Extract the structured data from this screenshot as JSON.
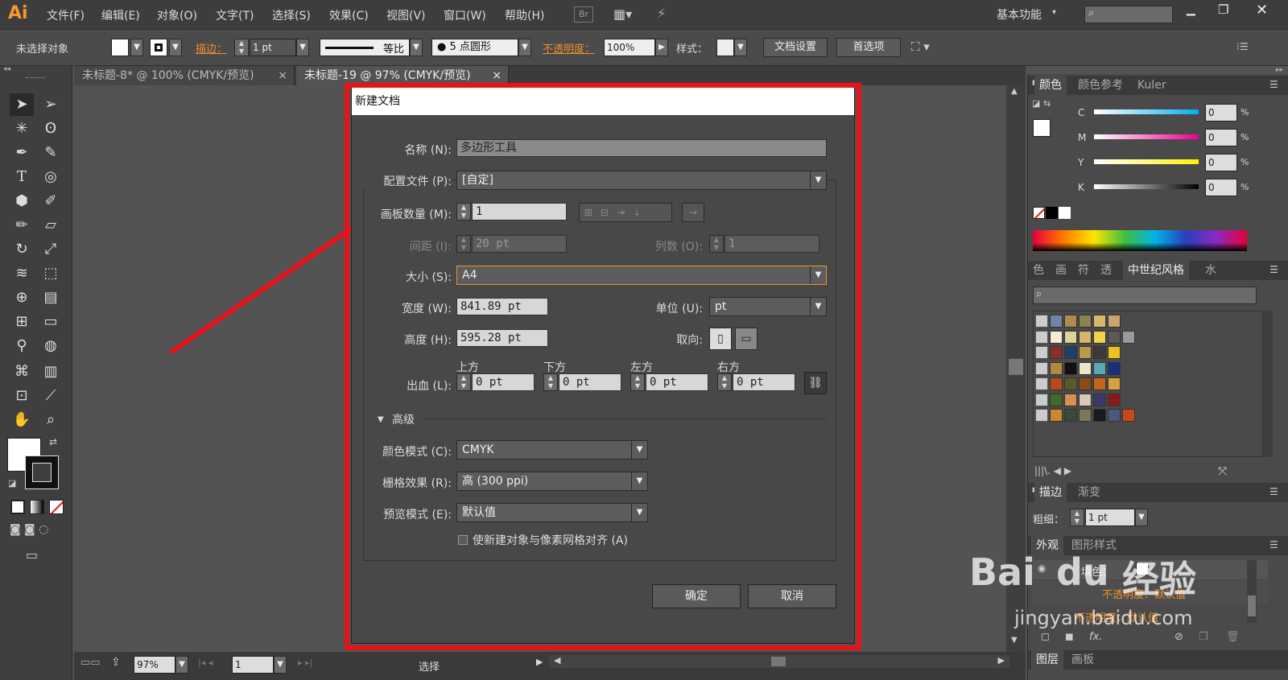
{
  "app": {
    "logo": "Ai",
    "workspace": "基本功能"
  },
  "menu": [
    "文件(F)",
    "编辑(E)",
    "对象(O)",
    "文字(T)",
    "选择(S)",
    "效果(C)",
    "视图(V)",
    "窗口(W)",
    "帮助(H)"
  ],
  "menu_extra": {
    "br": "Br"
  },
  "control": {
    "no_selection": "未选择对象",
    "stroke_label": "描边：",
    "stroke_value": "1 pt",
    "profile": "等比",
    "brush": "5 点圆形",
    "opacity_label": "不透明度：",
    "opacity_value": "100%",
    "style_label": "样式：",
    "doc_setup": "文档设置",
    "prefs": "首选项"
  },
  "tabs": [
    {
      "label": "未标题-8* @ 100% (CMYK/预览)",
      "close": "×"
    },
    {
      "label": "未标题-19 @ 97% (CMYK/预览)",
      "close": "×"
    }
  ],
  "dialog": {
    "title": "新建文档",
    "name_label": "名称 (N):",
    "name_value": "多边形工具",
    "profile_label": "配置文件 (P):",
    "profile_value": "[自定]",
    "artboards_label": "画板数量 (M):",
    "artboards_value": "1",
    "spacing_label": "间距 (I):",
    "spacing_value": "20 pt",
    "columns_label": "列数 (O):",
    "columns_value": "1",
    "size_label": "大小 (S):",
    "size_value": "A4",
    "width_label": "宽度 (W):",
    "width_value": "841.89 pt",
    "units_label": "单位 (U):",
    "units_value": "pt",
    "height_label": "高度 (H):",
    "height_value": "595.28 pt",
    "orientation_label": "取向:",
    "bleed_label": "出血 (L):",
    "bleed": [
      {
        "label": "上方",
        "value": "0 pt"
      },
      {
        "label": "下方",
        "value": "0 pt"
      },
      {
        "label": "左方",
        "value": "0 pt"
      },
      {
        "label": "右方",
        "value": "0 pt"
      }
    ],
    "advanced_label": "高级",
    "color_mode_label": "颜色模式 (C):",
    "color_mode_value": "CMYK",
    "raster_label": "栅格效果 (R):",
    "raster_value": "高 (300 ppi)",
    "preview_label": "预览模式 (E):",
    "preview_value": "默认值",
    "align_pixel_label": "使新建对象与像素网格对齐 (A)",
    "ok": "确定",
    "cancel": "取消"
  },
  "color_panel": {
    "tabs": [
      "颜色",
      "颜色参考",
      "Kuler"
    ],
    "channels": [
      {
        "name": "C",
        "value": "0",
        "unit": "%",
        "color": "#00aeef"
      },
      {
        "name": "M",
        "value": "0",
        "unit": "%",
        "color": "#ec008c"
      },
      {
        "name": "Y",
        "value": "0",
        "unit": "%",
        "color": "#fff200"
      },
      {
        "name": "K",
        "value": "0",
        "unit": "%",
        "color": "#000000"
      }
    ]
  },
  "swatch_panel": {
    "tabs": [
      "色板",
      "画笔",
      "符号",
      "透明",
      "中世纪风格",
      "水果"
    ],
    "rows": [
      [
        "#6b86a8",
        "#b08a4f",
        "#8c8450",
        "#d8b86a",
        "#c9a66b"
      ],
      [
        "#f3ecd6",
        "#dcd29a",
        "#d4b56a",
        "#f0d34a",
        "#5a5a5a",
        "#9a9a9a"
      ],
      [
        "#8a2f2a",
        "#1f3f6b",
        "#b79a4c",
        "#3a3a3a",
        "#f0c020"
      ],
      [
        "#b08a3a",
        "#111111",
        "#e8e8c8",
        "#5aa8b8",
        "#1a2f7a"
      ],
      [
        "#b84a1a",
        "#5a5a2a",
        "#8a4a1a",
        "#c8641a",
        "#d8a040"
      ],
      [
        "#3f6a2a",
        "#d89050",
        "#d8c8b8",
        "#3a3a6a",
        "#8a1a1a"
      ],
      [
        "#c88a2a",
        "#3a4a3a",
        "#7a7a5a",
        "#1a1a1a",
        "#4a5a7a",
        "#c8481a"
      ]
    ]
  },
  "stroke_panel": {
    "tabs": [
      "描边",
      "渐变"
    ],
    "weight_label": "粗细：",
    "weight_value": "1 pt"
  },
  "appearance_panel": {
    "tabs": [
      "外观",
      "图形样式"
    ],
    "fill_label": "填色：",
    "stroke_opacity": "不透明度：默认值",
    "opacity_row": "不透明度：默认值",
    "fx": "fx."
  },
  "layers_panel": {
    "tabs": [
      "图层",
      "画板"
    ]
  },
  "status": {
    "zoom": "97%",
    "page": "1",
    "mode": "选择"
  },
  "watermark": {
    "brand": "Bai",
    "paw": "du",
    "cn": "经验",
    "url": "jingyan.baidu.com"
  },
  "colors": {
    "highlight": "#e5141b",
    "accent": "#f08f2a",
    "ui_bg": "#535353"
  }
}
